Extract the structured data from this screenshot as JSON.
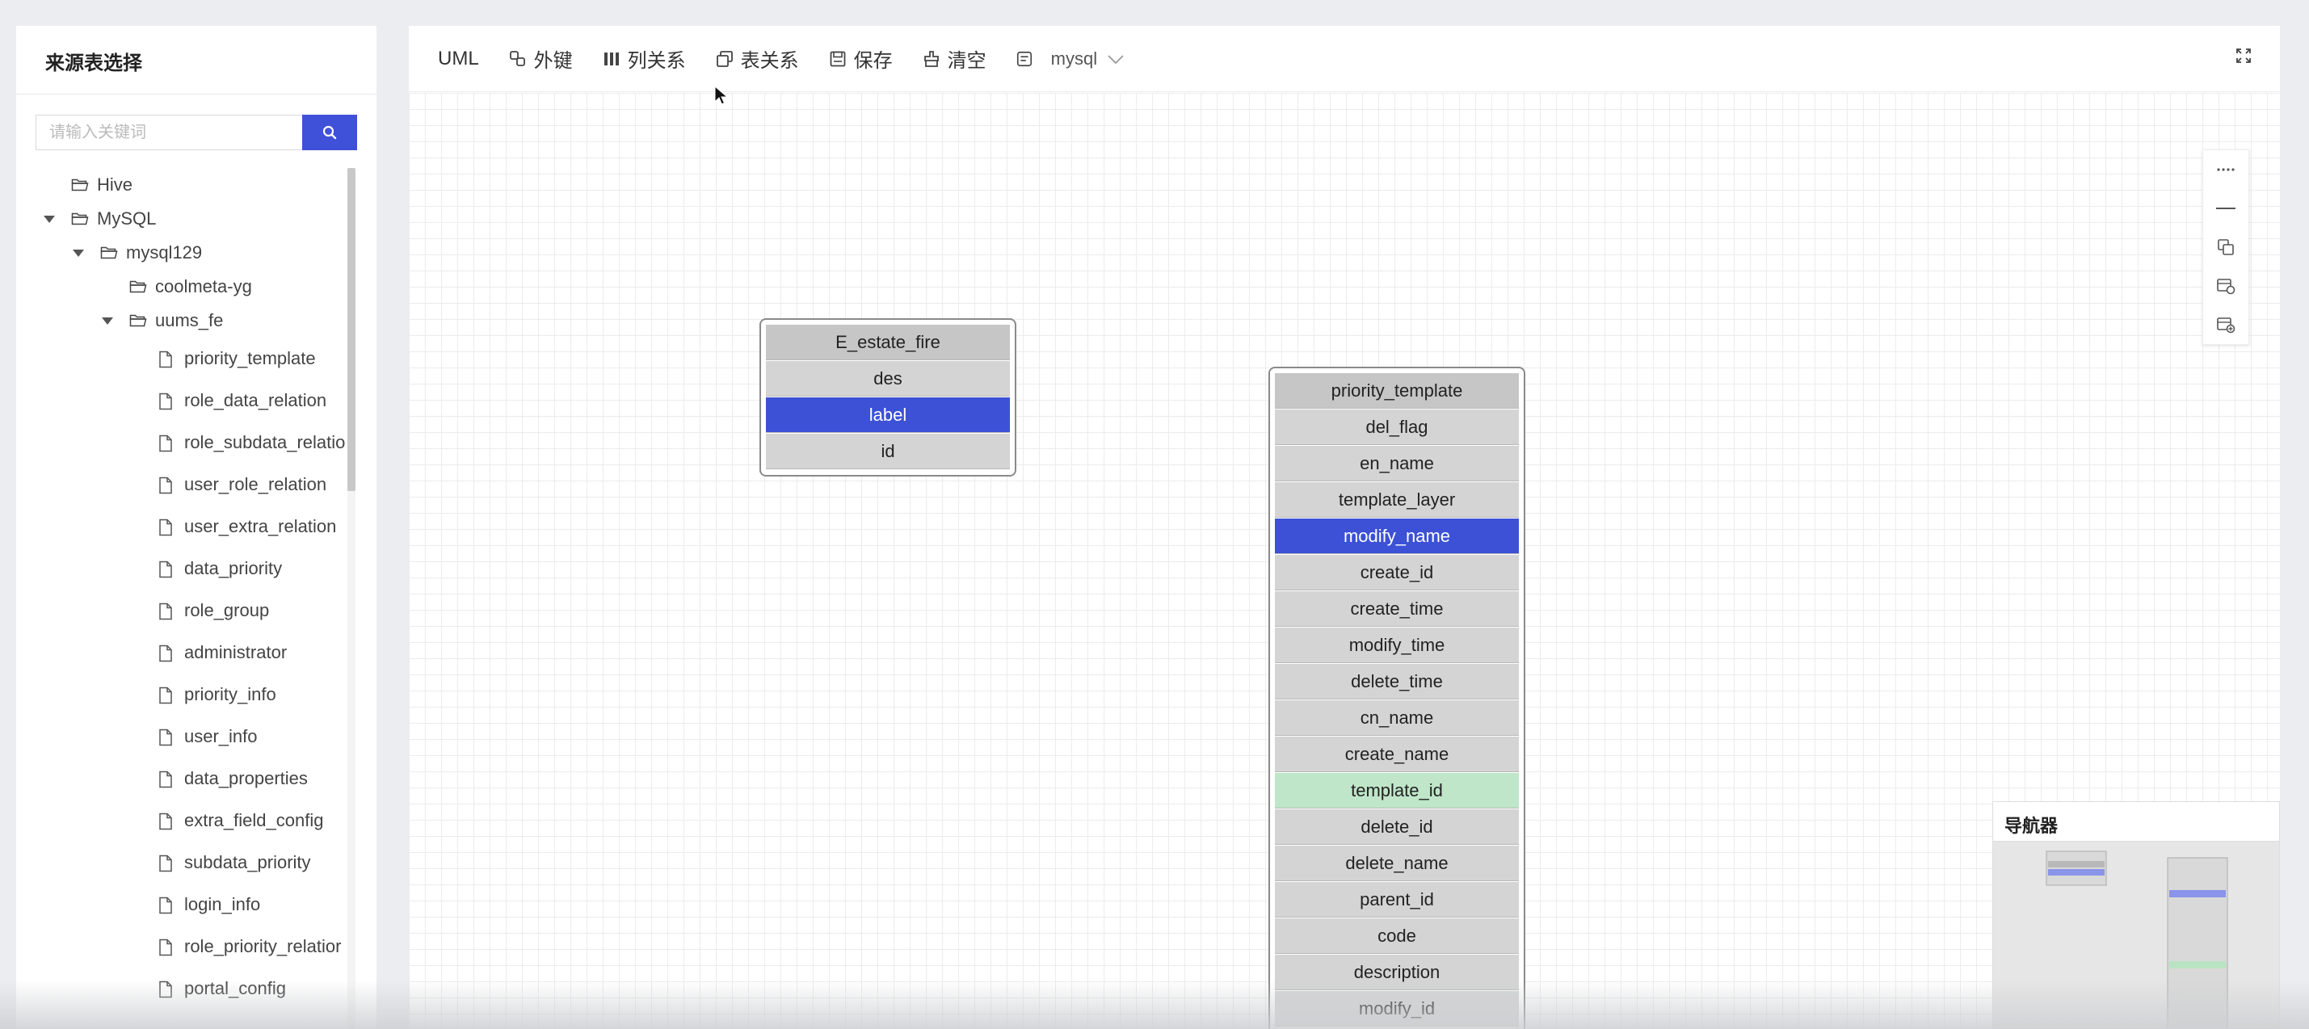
{
  "left_panel": {
    "title": "来源表选择",
    "search": {
      "placeholder": "请输入关键词",
      "value": ""
    },
    "tree": [
      {
        "label": "Hive",
        "type": "folder",
        "level": 1,
        "expanded": false
      },
      {
        "label": "MySQL",
        "type": "folder",
        "level": 1,
        "expanded": true
      },
      {
        "label": "mysql129",
        "type": "folder",
        "level": 2,
        "expanded": true
      },
      {
        "label": "coolmeta-yg",
        "type": "folder",
        "level": 3,
        "expanded": false
      },
      {
        "label": "uums_fe",
        "type": "folder",
        "level": 3,
        "expanded": true
      },
      {
        "label": "priority_template",
        "type": "file",
        "level": 4
      },
      {
        "label": "role_data_relation",
        "type": "file",
        "level": 4
      },
      {
        "label": "role_subdata_relatio",
        "type": "file",
        "level": 4
      },
      {
        "label": "user_role_relation",
        "type": "file",
        "level": 4
      },
      {
        "label": "user_extra_relation",
        "type": "file",
        "level": 4
      },
      {
        "label": "data_priority",
        "type": "file",
        "level": 4
      },
      {
        "label": "role_group",
        "type": "file",
        "level": 4
      },
      {
        "label": "administrator",
        "type": "file",
        "level": 4
      },
      {
        "label": "priority_info",
        "type": "file",
        "level": 4
      },
      {
        "label": "user_info",
        "type": "file",
        "level": 4
      },
      {
        "label": "data_properties",
        "type": "file",
        "level": 4
      },
      {
        "label": "extra_field_config",
        "type": "file",
        "level": 4
      },
      {
        "label": "subdata_priority",
        "type": "file",
        "level": 4
      },
      {
        "label": "login_info",
        "type": "file",
        "level": 4
      },
      {
        "label": "role_priority_relatior",
        "type": "file",
        "level": 4
      },
      {
        "label": "portal_config",
        "type": "file",
        "level": 4
      }
    ]
  },
  "toolbar": {
    "uml": "UML",
    "foreign_key": "外键",
    "column_relation": "列关系",
    "table_relation": "表关系",
    "save": "保存",
    "clear": "清空",
    "db_type": "mysql"
  },
  "tables": [
    {
      "name": "E_estate_fire",
      "columns": [
        {
          "name": "des",
          "state": "normal"
        },
        {
          "name": "label",
          "state": "selected"
        },
        {
          "name": "id",
          "state": "normal"
        }
      ]
    },
    {
      "name": "priority_template",
      "columns": [
        {
          "name": "del_flag",
          "state": "normal"
        },
        {
          "name": "en_name",
          "state": "normal"
        },
        {
          "name": "template_layer",
          "state": "normal"
        },
        {
          "name": "modify_name",
          "state": "selected"
        },
        {
          "name": "create_id",
          "state": "normal"
        },
        {
          "name": "create_time",
          "state": "normal"
        },
        {
          "name": "modify_time",
          "state": "normal"
        },
        {
          "name": "delete_time",
          "state": "normal"
        },
        {
          "name": "cn_name",
          "state": "normal"
        },
        {
          "name": "create_name",
          "state": "normal"
        },
        {
          "name": "template_id",
          "state": "key"
        },
        {
          "name": "delete_id",
          "state": "normal"
        },
        {
          "name": "delete_name",
          "state": "normal"
        },
        {
          "name": "parent_id",
          "state": "normal"
        },
        {
          "name": "code",
          "state": "normal"
        },
        {
          "name": "description",
          "state": "normal"
        },
        {
          "name": "modify_id",
          "state": "normal"
        }
      ]
    }
  ],
  "navigator": {
    "title": "导航器"
  },
  "colors": {
    "accent": "#3f51d8",
    "selected_row": "#3c51d6",
    "key_row": "#bfe6c8",
    "row": "#d4d4d4"
  },
  "icons": [
    "search-icon",
    "folder-icon",
    "file-icon",
    "foreign-key-icon",
    "columns-icon",
    "table-relation-icon",
    "save-icon",
    "clear-icon",
    "db-icon",
    "chevron-down-icon",
    "fullscreen-icon",
    "more-icon",
    "minus-icon",
    "copy-icon",
    "table-settings-icon",
    "table-add-icon"
  ]
}
